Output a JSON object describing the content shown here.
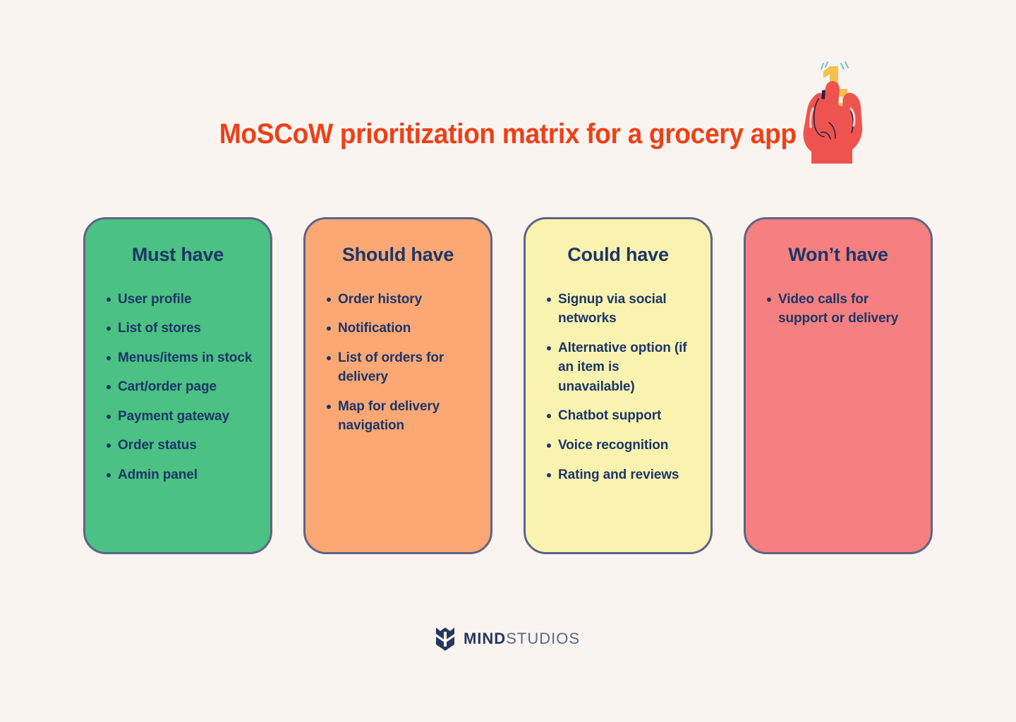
{
  "page": {
    "title": "MoSCoW prioritization matrix for a grocery app",
    "background_color": "#FAF4F1",
    "title_color": "#EE4017",
    "text_color": "#1C3668",
    "border_color": "#5E6486"
  },
  "illustration": {
    "name": "hand-holding-number-one",
    "hand_color": "#EF5350",
    "number_color": "#F0C44C",
    "accent_color": "#1F2548",
    "sparkle_color": "#6FC7C7"
  },
  "columns": [
    {
      "key": "must",
      "title": "Must have",
      "color": "#4BC183",
      "items": [
        "User profile",
        "List of stores",
        "Menus/items in stock",
        "Cart/order page",
        "Payment gateway",
        "Order status",
        "Admin panel"
      ]
    },
    {
      "key": "should",
      "title": "Should have",
      "color": "#FBA875",
      "items": [
        "Order history",
        "Notification",
        "List of orders for delivery",
        "Map for delivery navigation"
      ]
    },
    {
      "key": "could",
      "title": "Could have",
      "color": "#FAF3AF",
      "items": [
        "Signup via social networks",
        "Alternative option (if an item is unavailable)",
        "Chatbot support",
        "Voice recognition",
        "Rating and reviews"
      ]
    },
    {
      "key": "wont",
      "title": "Won’t have",
      "color": "#F5807F",
      "items": [
        "Video calls for support or delivery"
      ]
    }
  ],
  "footer": {
    "logo_icon": "mind-studios-shield-icon",
    "brand_primary": "MIND",
    "brand_secondary": "STUDIOS"
  }
}
